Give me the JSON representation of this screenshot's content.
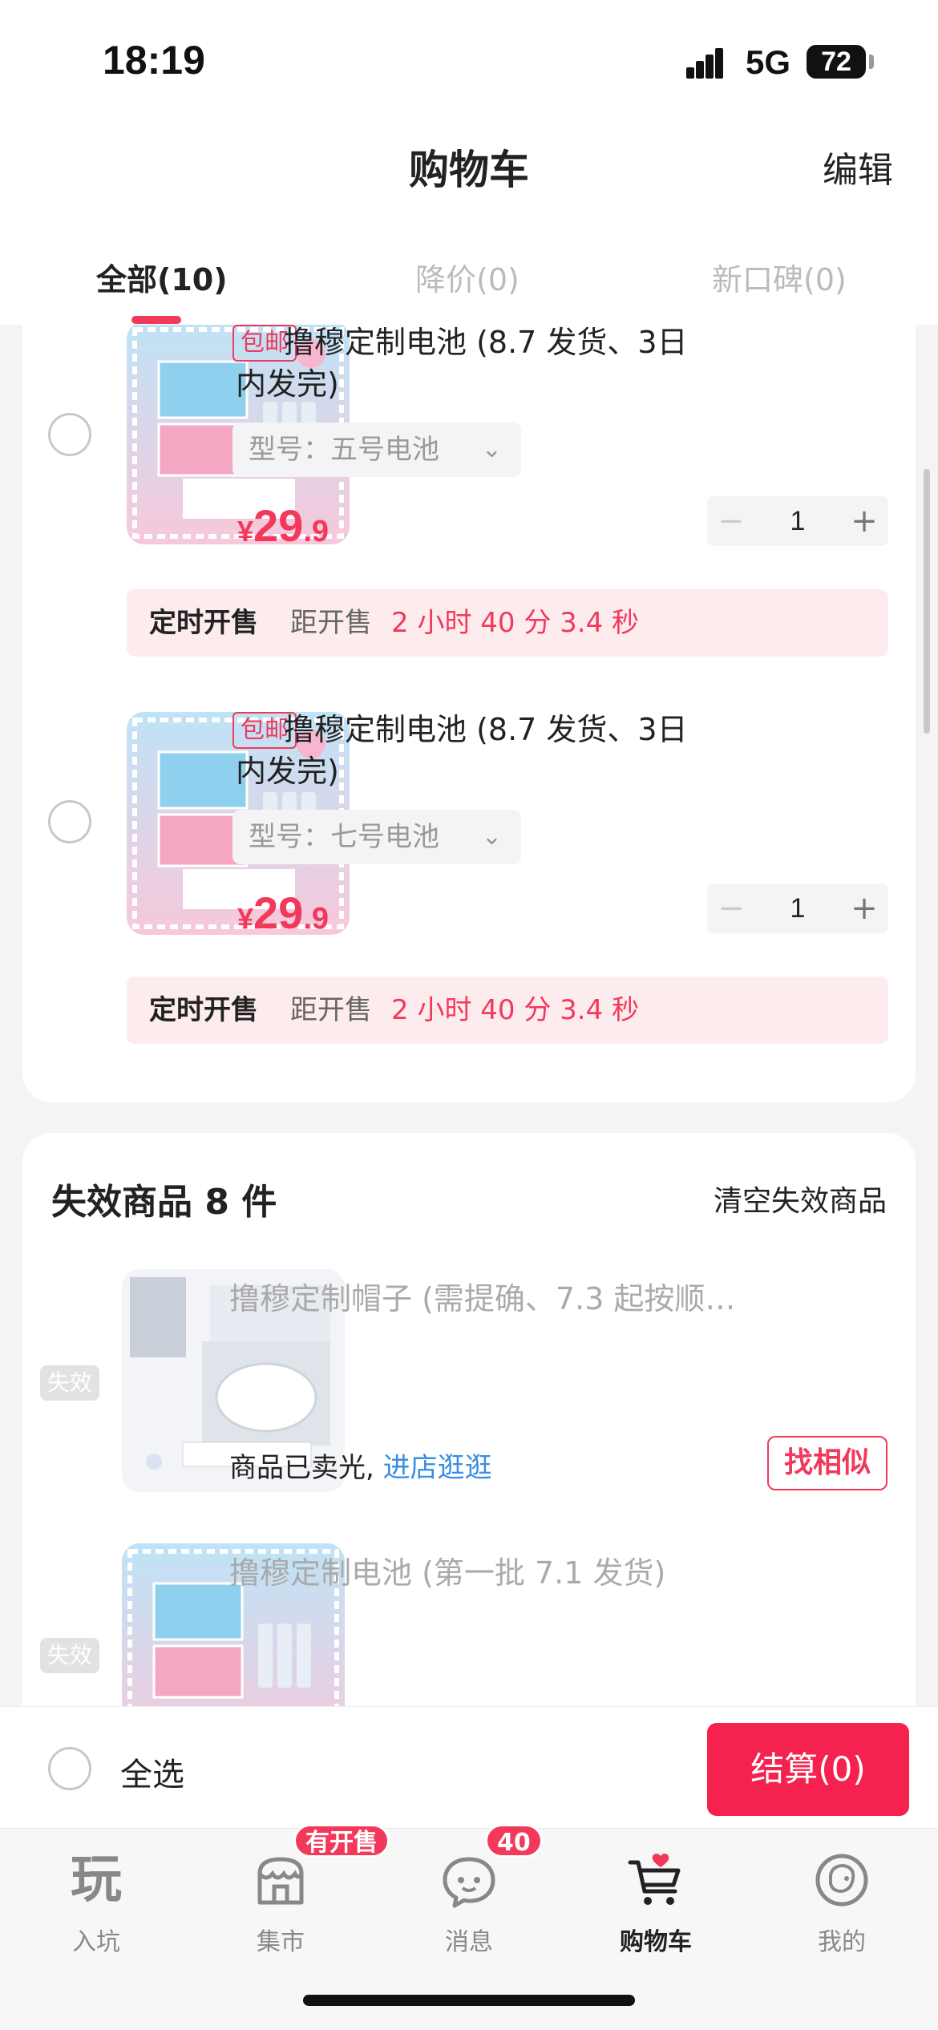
{
  "status_bar": {
    "time": "18:19",
    "network": "5G",
    "battery": "72"
  },
  "header": {
    "title": "购物车",
    "edit_label": "编辑"
  },
  "tabs": [
    {
      "label": "全部(10)",
      "active": true
    },
    {
      "label": "降价(0)",
      "active": false
    },
    {
      "label": "新口碑(0)",
      "active": false
    }
  ],
  "cart_items": [
    {
      "badge": "包邮",
      "title_line1": "撸穆定制电池 (8.7 发货、3日",
      "title_line2": "内发完)",
      "variant": "型号：五号电池",
      "price_currency": "¥",
      "price_int": "29",
      "price_dec": ".9",
      "quantity": "1",
      "timer_label": "定时开售",
      "timer_prefix": "距开售",
      "timer_countdown": "2 小时 40 分 3.4 秒"
    },
    {
      "badge": "包邮",
      "title_line1": "撸穆定制电池 (8.7 发货、3日",
      "title_line2": "内发完)",
      "variant": "型号：七号电池",
      "price_currency": "¥",
      "price_int": "29",
      "price_dec": ".9",
      "quantity": "1",
      "timer_label": "定时开售",
      "timer_prefix": "距开售",
      "timer_countdown": "2 小时 40 分 3.4 秒"
    }
  ],
  "invalid_section": {
    "title": "失效商品 8 件",
    "clear_label": "清空失效商品",
    "items": [
      {
        "badge": "失效",
        "title": "撸穆定制帽子 (需提确、7.3 起按顺…",
        "status": "商品已卖光,",
        "visit_link": "进店逛逛",
        "similar_label": "找相似"
      },
      {
        "badge": "失效",
        "title": "撸穆定制电池 (第一批 7.1 发货)"
      }
    ]
  },
  "checkout": {
    "select_all": "全选",
    "button": "结算(0)"
  },
  "tab_bar": [
    {
      "label": "入坑",
      "icon": "play-char-icon",
      "active": false
    },
    {
      "label": "集市",
      "icon": "store-icon",
      "active": false,
      "badge": "有开售"
    },
    {
      "label": "消息",
      "icon": "chat-bubble-icon",
      "active": false,
      "badge": "40"
    },
    {
      "label": "购物车",
      "icon": "cart-heart-icon",
      "active": true
    },
    {
      "label": "我的",
      "icon": "profile-avatar-icon",
      "active": false
    }
  ],
  "colors": {
    "accent": "#f2395b",
    "link": "#3b8fe0",
    "checkout": "#f5214f"
  }
}
